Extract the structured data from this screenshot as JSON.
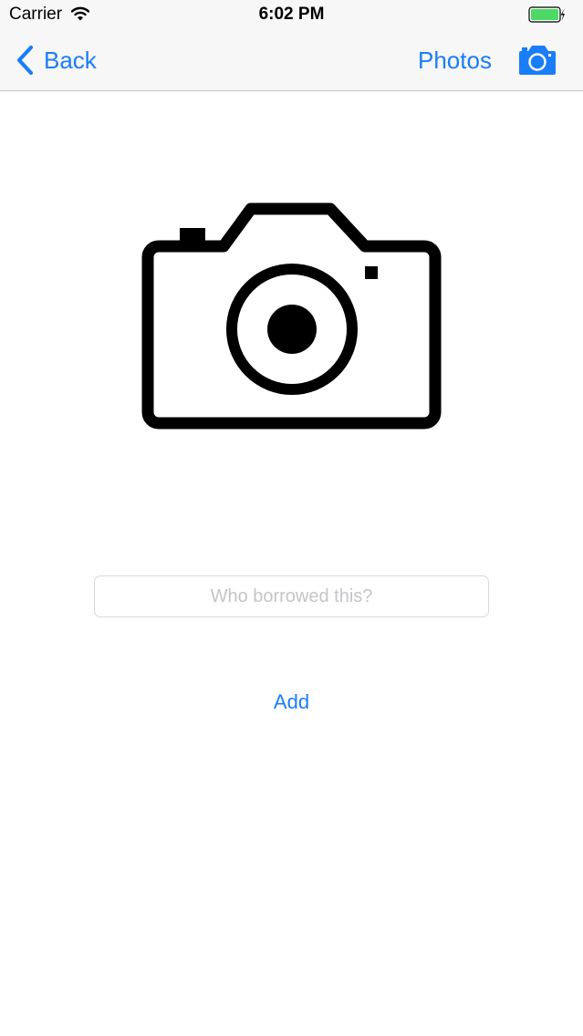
{
  "status_bar": {
    "carrier": "Carrier",
    "time": "6:02 PM"
  },
  "nav": {
    "back_label": "Back",
    "photos_label": "Photos",
    "camera_icon": "camera-icon"
  },
  "content": {
    "hero_icon": "camera-icon",
    "borrower_input": {
      "value": "",
      "placeholder": "Who borrowed this?"
    },
    "add_label": "Add"
  },
  "colors": {
    "accent": "#1a7df9",
    "battery": "#4cd964",
    "nav_background": "#f7f7f7"
  }
}
